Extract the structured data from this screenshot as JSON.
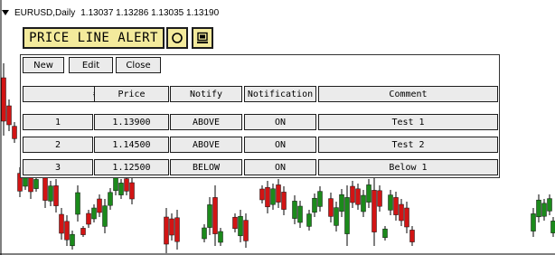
{
  "chart": {
    "symbol": "EURUSD,Daily",
    "ohlc": "1.13037 1.13286 1.13035 1.13190",
    "colors": {
      "up": "#1b8a1b",
      "down": "#d21414",
      "wick": "#000000",
      "axis": "#000000"
    }
  },
  "alert_panel": {
    "title": "PRICE LINE ALERT",
    "title_icons": [
      "circle-icon",
      "monitor-icon"
    ],
    "buttons": {
      "new": "New",
      "edit": "Edit",
      "close": "Close"
    },
    "columns": [
      "#",
      "Price",
      "Notify",
      "Notification",
      "Comment"
    ],
    "rows": [
      {
        "num": "1",
        "price": "1.13900",
        "notify": "ABOVE",
        "notification": "ON",
        "comment": "Test 1"
      },
      {
        "num": "2",
        "price": "1.14500",
        "notify": "ABOVE",
        "notification": "ON",
        "comment": "Test 2"
      },
      {
        "num": "3",
        "price": "1.12500",
        "notify": "BELOW",
        "notification": "ON",
        "comment": "Below 1"
      }
    ]
  }
}
